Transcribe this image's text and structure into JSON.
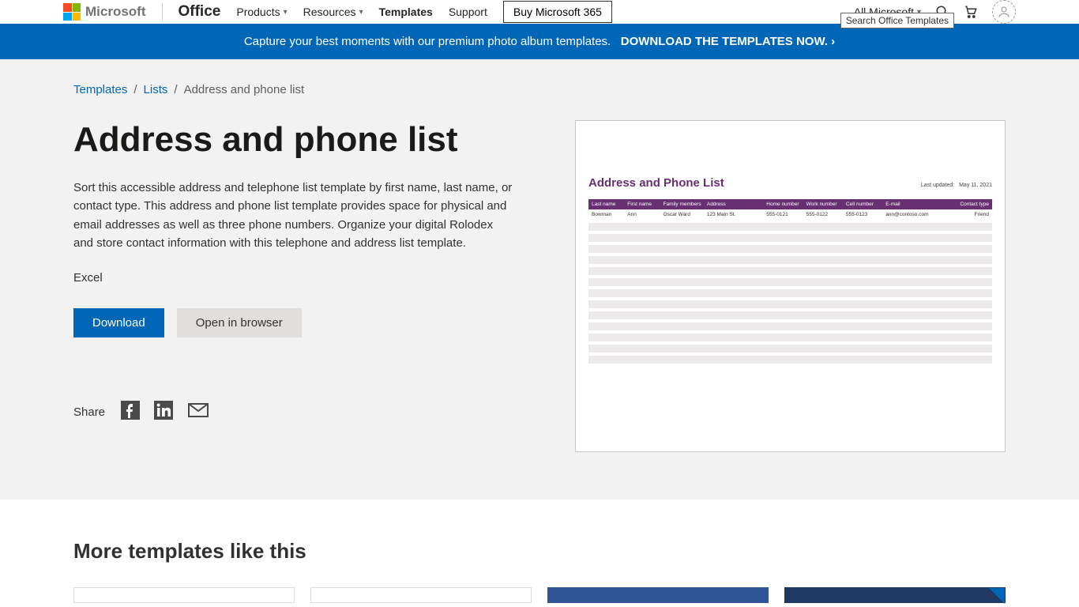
{
  "nav": {
    "brand": "Microsoft",
    "office": "Office",
    "products": "Products",
    "resources": "Resources",
    "templates": "Templates",
    "support": "Support",
    "buy": "Buy Microsoft 365",
    "all_ms": "All Microsoft",
    "search_tooltip": "Search Office Templates"
  },
  "promo": {
    "text": "Capture your best moments with our premium photo album templates.",
    "cta": "DOWNLOAD THE TEMPLATES NOW."
  },
  "breadcrumbs": {
    "l1": "Templates",
    "l2": "Lists",
    "current": "Address and phone list"
  },
  "template": {
    "title": "Address and phone list",
    "description": "Sort this accessible address and telephone list template by first name, last name, or contact type. This address and phone list template provides space for physical and email addresses as well as three phone numbers. Organize your digital Rolodex and store contact information with this telephone and address list template.",
    "app": "Excel",
    "download": "Download",
    "open": "Open in browser"
  },
  "share": {
    "label": "Share"
  },
  "preview": {
    "title": "Address and Phone List",
    "updated_label": "Last updated:",
    "updated_date": "May 11, 2021",
    "headers": {
      "last_name": "Last name",
      "first_name": "First name",
      "family": "Family members",
      "address": "Address",
      "home": "Home number",
      "work": "Work number",
      "cell": "Cell number",
      "email": "E-mail",
      "contact_type": "Contact type"
    },
    "row": {
      "last_name": "Bowman",
      "first_name": "Ann",
      "family": "Oscar Ward",
      "address": "123 Main St.",
      "home": "555-0121",
      "work": "555-0122",
      "cell": "555-0123",
      "email": "ann@contoso.com",
      "contact_type": "Friend"
    }
  },
  "more": {
    "title": "More templates like this"
  }
}
